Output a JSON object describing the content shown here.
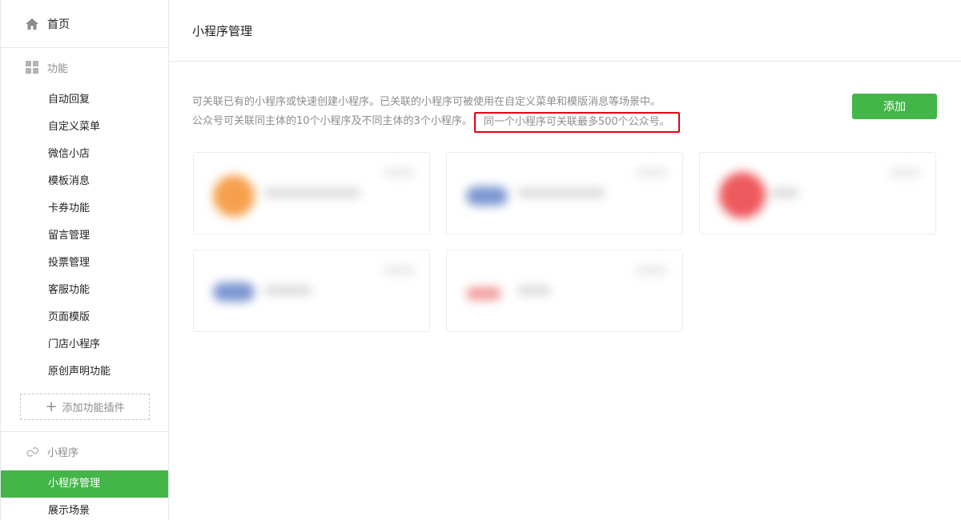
{
  "sidebar": {
    "home_label": "首页",
    "function_group_label": "功能",
    "function_items": [
      "自动回复",
      "自定义菜单",
      "微信小店",
      "模板消息",
      "卡券功能",
      "留言管理",
      "投票管理",
      "客服功能",
      "页面模版",
      "门店小程序",
      "原创声明功能"
    ],
    "add_plugin_label": "添加功能插件",
    "mini_group_label": "小程序",
    "mini_items": [
      "小程序管理",
      "展示场景"
    ],
    "active_item": "小程序管理"
  },
  "main": {
    "title": "小程序管理",
    "desc_line1": "可关联已有的小程序或快速创建小程序。已关联的小程序可被使用在自定义菜单和模版消息等场景中。",
    "desc_line2": "公众号可关联同主体的10个小程序及不同主体的3个小程序。",
    "desc_highlight": "同一个小程序可关联最多500个公众号。",
    "add_button_label": "添加",
    "highlight_border_color": "#e60012"
  },
  "colors": {
    "accent": "#44b549",
    "muted_text": "#8d8d8d",
    "border": "#e7e7eb"
  }
}
